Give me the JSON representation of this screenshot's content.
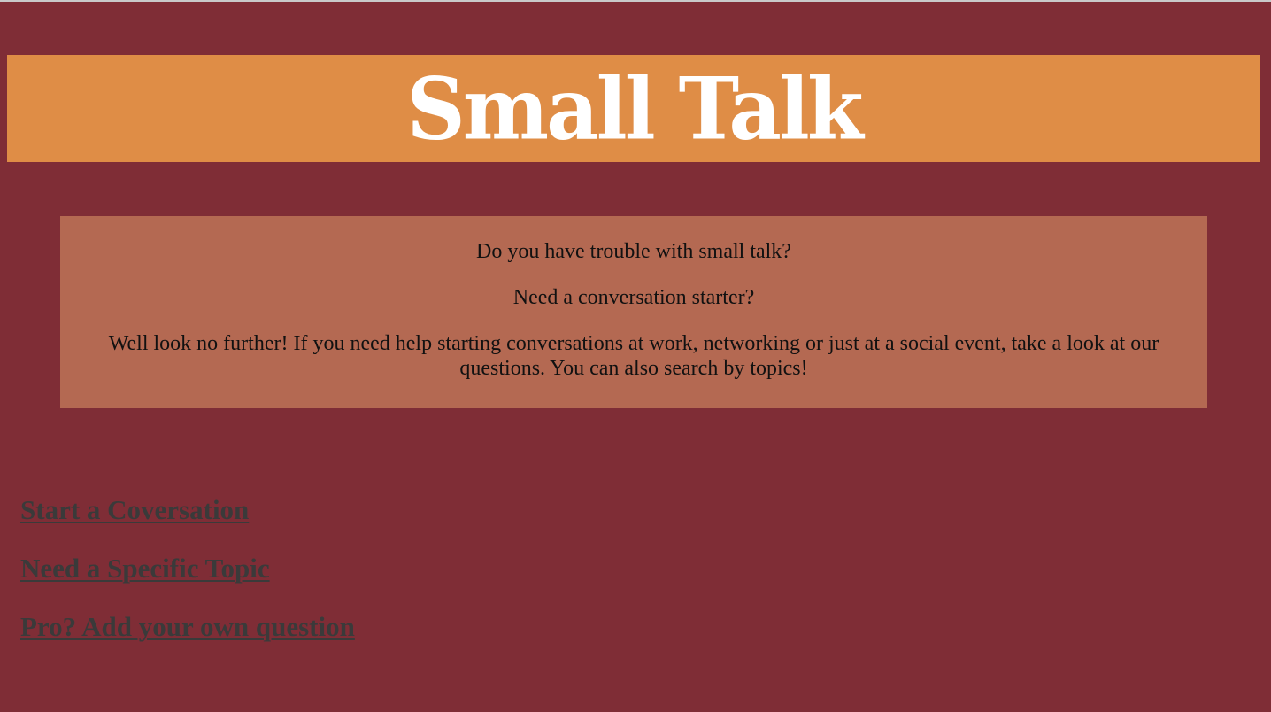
{
  "header": {
    "title": "Small Talk"
  },
  "intro": {
    "lines": [
      "Do you have trouble with small talk?",
      "Need a conversation starter?",
      "Well look no further! If you need help starting conversations at work, networking or just at a social event, take a look at our questions. You can also search by topics!"
    ]
  },
  "nav": {
    "links": [
      "Start a Coversation",
      "Need a Specific Topic",
      "Pro? Add your own question"
    ]
  },
  "colors": {
    "page_background": "#7f2d36",
    "header_background": "#df8d46",
    "intro_background": "#b46952",
    "link_color": "#3a3a3a"
  }
}
